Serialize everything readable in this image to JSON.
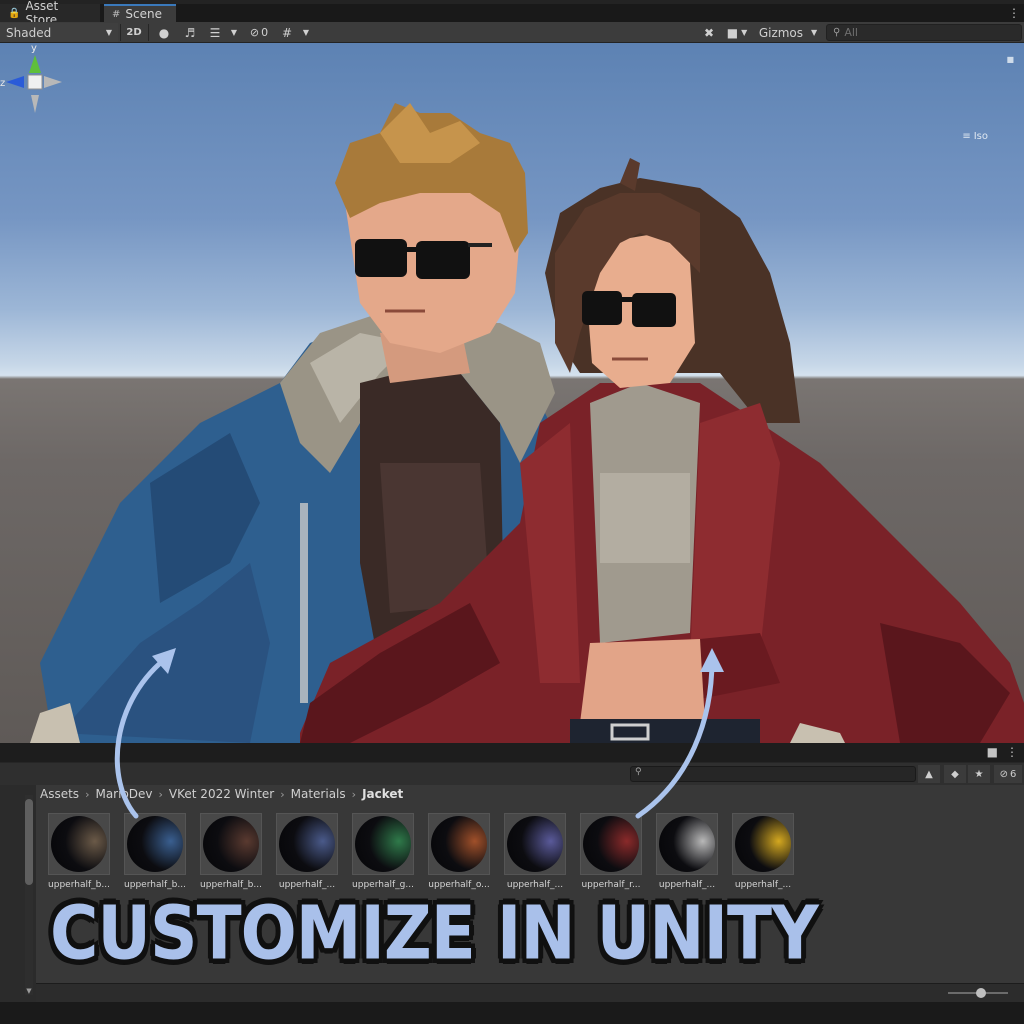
{
  "tabs": [
    {
      "label": "Asset Store",
      "icon": "lock-icon"
    },
    {
      "label": "Scene",
      "icon": "grid-icon"
    }
  ],
  "scene_toolbar": {
    "draw_mode": "Shaded",
    "mode_2d": "2D",
    "hidden_count": "0",
    "gizmos": "Gizmos",
    "search_placeholder": "All"
  },
  "gizmo": {
    "y_label": "y",
    "z_label": "z",
    "projection": "Iso"
  },
  "project": {
    "hidden_count": "6",
    "breadcrumb": [
      "Assets",
      "MarioDev",
      "VKet 2022 Winter",
      "Materials",
      "Jacket"
    ],
    "assets": [
      {
        "label": "upperhalf_b...",
        "color": "#6b5a48"
      },
      {
        "label": "upperhalf_b...",
        "color": "#3a5f90"
      },
      {
        "label": "upperhalf_b...",
        "color": "#5a3a30"
      },
      {
        "label": "upperhalf_...",
        "color": "#4a5a8a"
      },
      {
        "label": "upperhalf_g...",
        "color": "#2f7a4a"
      },
      {
        "label": "upperhalf_o...",
        "color": "#a0502a"
      },
      {
        "label": "upperhalf_...",
        "color": "#5a5a9a"
      },
      {
        "label": "upperhalf_r...",
        "color": "#8a2a2a"
      },
      {
        "label": "upperhalf_...",
        "color": "#b8b8b8"
      },
      {
        "label": "upperhalf_...",
        "color": "#d4a820"
      }
    ]
  },
  "overlay": {
    "title": "CUSTOMIZE IN UNITY",
    "color": "#a9c0ea"
  }
}
